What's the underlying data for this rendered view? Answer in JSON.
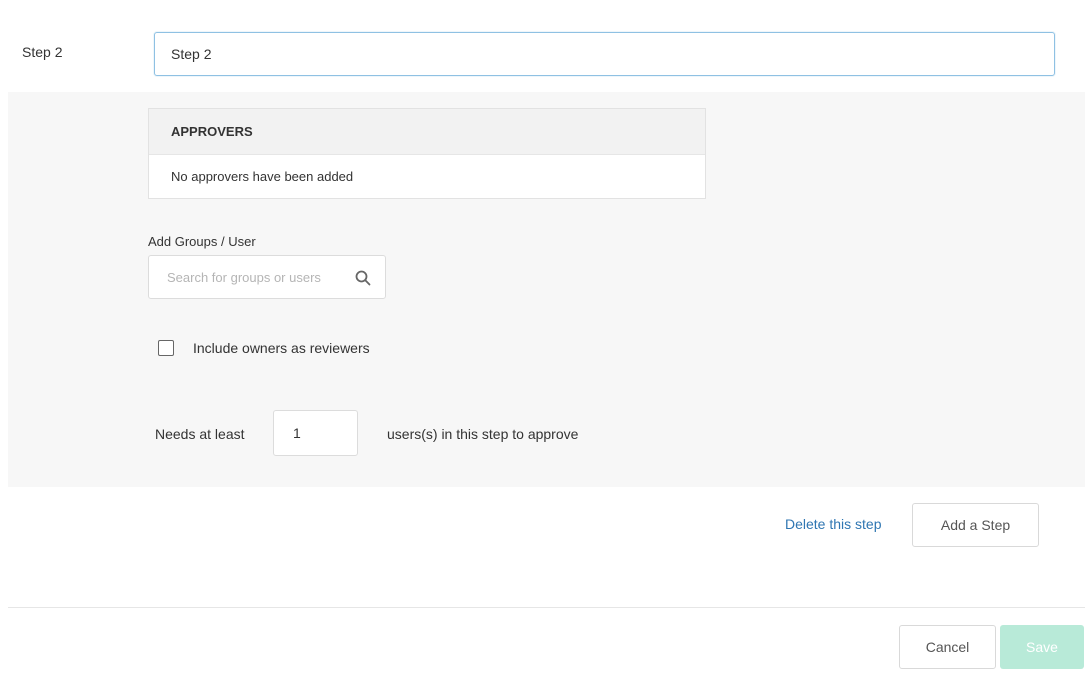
{
  "step": {
    "label": "Step 2",
    "name_value": "Step 2"
  },
  "approvers": {
    "header": "APPROVERS",
    "empty_message": "No approvers have been added"
  },
  "add_groups": {
    "label": "Add Groups / User",
    "search_placeholder": "Search for groups or users",
    "search_icon": "search-icon"
  },
  "include_owners": {
    "label": "Include owners as reviewers",
    "checked": false
  },
  "needs": {
    "prefix": "Needs at least",
    "value": "1",
    "suffix": "users(s) in this step to approve"
  },
  "step_actions": {
    "delete_label": "Delete this step",
    "add_label": "Add a Step"
  },
  "footer": {
    "cancel_label": "Cancel",
    "save_label": "Save"
  },
  "colors": {
    "link": "#2f76b2",
    "save_disabled": "#b8ead8",
    "input_focus_border": "#8fc1e3",
    "panel_background": "#f7f7f7"
  }
}
